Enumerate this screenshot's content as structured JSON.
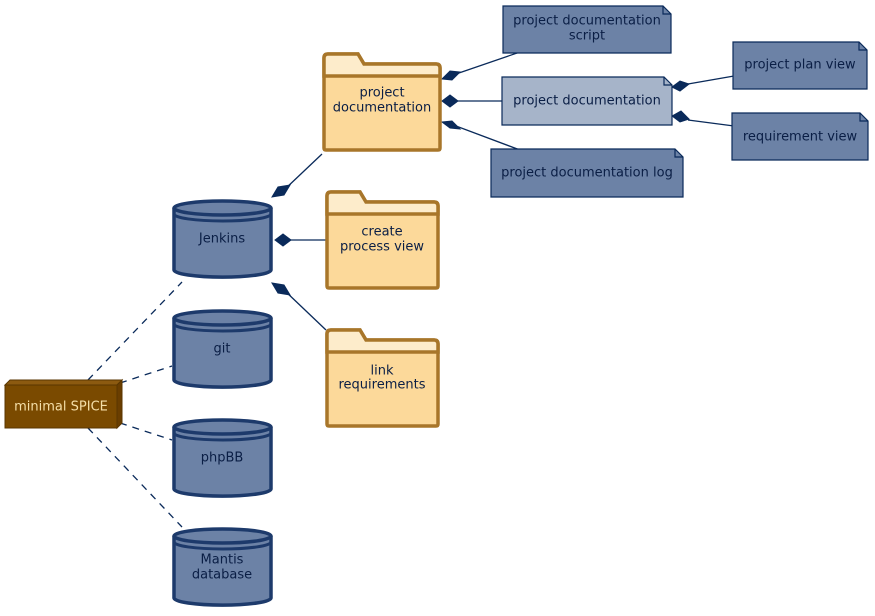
{
  "diagram": {
    "colors": {
      "root_fill": "#7a4a00",
      "root_text": "#f5dfa8",
      "db_fill": "#6c82a6",
      "db_stroke": "#1d3a6b",
      "folder_fill": "#fcd99a",
      "folder_tab": "#fdeccb",
      "folder_stroke": "#a8762a",
      "note_fill": "#6c82a6",
      "note_highlight_fill": "#a6b4c9",
      "note_stroke": "#0a2a5a",
      "edge": "#0a2a5a"
    },
    "root": {
      "label": "minimal SPICE"
    },
    "databases": [
      {
        "id": "jenkins",
        "lines": [
          "Jenkins"
        ]
      },
      {
        "id": "git",
        "lines": [
          "git"
        ]
      },
      {
        "id": "phpbb",
        "lines": [
          "phpBB"
        ]
      },
      {
        "id": "mantis",
        "lines": [
          "Mantis",
          "database"
        ]
      }
    ],
    "folders": [
      {
        "id": "project-documentation-folder",
        "lines": [
          "project",
          "documentation"
        ]
      },
      {
        "id": "create-process-view",
        "lines": [
          "create",
          "process view"
        ]
      },
      {
        "id": "link-requirements",
        "lines": [
          "link",
          "requirements"
        ]
      }
    ],
    "notes": [
      {
        "id": "project-documentation-script",
        "lines": [
          "project documentation",
          "script"
        ]
      },
      {
        "id": "project-documentation",
        "lines": [
          "project documentation"
        ]
      },
      {
        "id": "project-documentation-log",
        "lines": [
          "project documentation log"
        ]
      },
      {
        "id": "project-plan-view",
        "lines": [
          "project plan view"
        ]
      },
      {
        "id": "requirement-view",
        "lines": [
          "requirement view"
        ]
      }
    ],
    "edges": [
      {
        "from": "minimal SPICE",
        "to": "Jenkins",
        "style": "dashed"
      },
      {
        "from": "minimal SPICE",
        "to": "git",
        "style": "dashed"
      },
      {
        "from": "minimal SPICE",
        "to": "phpBB",
        "style": "dashed"
      },
      {
        "from": "minimal SPICE",
        "to": "Mantis database",
        "style": "dashed"
      },
      {
        "from": "Jenkins",
        "to": "project documentation (folder)",
        "style": "composition"
      },
      {
        "from": "Jenkins",
        "to": "create process view",
        "style": "composition"
      },
      {
        "from": "Jenkins",
        "to": "link requirements",
        "style": "composition"
      },
      {
        "from": "project documentation (folder)",
        "to": "project documentation script",
        "style": "composition"
      },
      {
        "from": "project documentation (folder)",
        "to": "project documentation",
        "style": "composition"
      },
      {
        "from": "project documentation (folder)",
        "to": "project documentation log",
        "style": "composition"
      },
      {
        "from": "project documentation",
        "to": "project plan view",
        "style": "composition"
      },
      {
        "from": "project documentation",
        "to": "requirement view",
        "style": "composition"
      }
    ]
  }
}
